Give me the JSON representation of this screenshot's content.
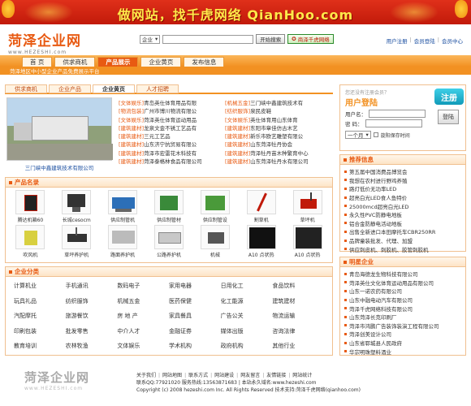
{
  "banner": {
    "text": "做网站，找千虎网络 QianHoo.com"
  },
  "logo": {
    "name": "菏泽企业网",
    "domain": "www.HEZESHI.com"
  },
  "search": {
    "scope": "企业",
    "button": "开始搜索",
    "free_button": "商泽千虎网络"
  },
  "top_links": [
    "用户注册",
    "会员登陆",
    "会员中心"
  ],
  "nav": {
    "items": [
      "首 页",
      "供求商机",
      "产品展示",
      "企业黄页",
      "发布信息"
    ],
    "active": 2
  },
  "subnav": {
    "text": "菏泽地区中小型企业产品免费展示平台"
  },
  "tabs": {
    "items": [
      "供求商机",
      "企业产品",
      "企业黄页",
      "人才招聘"
    ],
    "active": 2
  },
  "feature": {
    "caption": "三门峡中鑫建筑技术有限公司"
  },
  "news": [
    [
      {
        "tag": "[文体娱乐]",
        "text": "青岛英仕体育用品有限"
      },
      {
        "tag": "[机械五金]",
        "text": "三门峡中鑫建筑技术有"
      }
    ],
    [
      {
        "tag": "[物流包装]",
        "text": "广州市博川物流有限公"
      },
      {
        "tag": "[纺织服饰]",
        "text": "泉民皮鞋"
      }
    ],
    [
      {
        "tag": "[文体娱乐]",
        "text": "菏泽英仕体育运动用品"
      },
      {
        "tag": "[文体娱乐]",
        "text": "英仕体育用山东体育"
      }
    ],
    [
      {
        "tag": "[建筑建材]",
        "text": "龙泉文金不锈工艺品有"
      },
      {
        "tag": "[建筑建材]",
        "text": "东阳市章佳仿古木艺"
      }
    ],
    [
      {
        "tag": "[建筑建材]",
        "text": "三元工艺品"
      },
      {
        "tag": "[建筑建材]",
        "text": "新乐市欧艺雕塑有限公"
      }
    ],
    [
      {
        "tag": "[建筑建材]",
        "text": "山东济宁抗贸易有限公"
      },
      {
        "tag": "[建筑建材]",
        "text": "山东菏泽牡丹协会"
      }
    ],
    [
      {
        "tag": "[建筑建材]",
        "text": "菏泽市宏雷花木科技有"
      },
      {
        "tag": "[建筑建材]",
        "text": "菏泽牡丹苗木种繁育中心"
      }
    ],
    [
      {
        "tag": "[建筑建材]",
        "text": "菏泽泰格林食品有限公司"
      },
      {
        "tag": "[建筑建材]",
        "text": "山东菏泽牡丹水有限公司"
      }
    ]
  ],
  "login": {
    "hint": "您还没有注册会员？",
    "title": "用户登陆",
    "register": "注册",
    "username_label": "用户名：",
    "password_label": "密  码：",
    "login_button": "登陆",
    "expiry": "一个月",
    "remember": "旋阳保存时间"
  },
  "recommend": {
    "title": "推荐信息",
    "items": [
      "第五届中国消费品博览会",
      "我想在农村进行野鸡养殖",
      "路灯低价无功率LED",
      "超亮白光LED食人鱼特价",
      "25000mcd超亮白光LED",
      "永久性PVC防静电地板",
      "铝合金防静电活动地板",
      "出售全新进口本田摩托车CBR250RR",
      "品牌童装批发、代理、加盟",
      "供应刺皮机、刺胶机、胶管刺胶机"
    ]
  },
  "members": {
    "title": "明星企业",
    "items": [
      "青岛海德龙生物科技有限公司",
      "菏泽英仕文化体育运动用品有限公司",
      "山东一诺农药有限公司",
      "山东中融电动汽车有限公司",
      "菏泽千虎网络科技有限公司",
      "山东菏泽长克印刷厂",
      "菏泽市鸿鹏广告装饰装演工程有限公司",
      "菏泽创美设计公司",
      "山东省郓城县人民政府",
      "华宗明珠塑料酒业"
    ]
  },
  "products": {
    "title": "产品名录",
    "items": [
      "腾达机箱60",
      "长城cesocm",
      "供应制管机",
      "供应制管材",
      "供应制管设",
      "割草机",
      "草坪机",
      "吹风机",
      "草坪养护机",
      "路面养护机",
      "公路养护机",
      "机械",
      "A10 点状热",
      "A10 点状热"
    ]
  },
  "categories": {
    "title": "企业分类",
    "items": [
      "计算机业",
      "手机通讯",
      "数码电子",
      "家用电器",
      "日用化工",
      "食品饮料",
      "玩具礼品",
      "纺织服饰",
      "机械五金",
      "医药保健",
      "化工能源",
      "建筑建材",
      "汽配摩托",
      "旅游餐饮",
      "房 地 产",
      "家具餐具",
      "广告公关",
      "物流运输",
      "印刷包装",
      "批发零售",
      "中介人才",
      "金融证券",
      "媒体出版",
      "咨询法律",
      "教育培训",
      "农林牧渔",
      "文体娱乐",
      "学术机构",
      "政府机构",
      "其他行业"
    ]
  },
  "footer": {
    "links": [
      "关于我们",
      "网站地图",
      "联系方式",
      "网站建设",
      "网友留言",
      "友情链接",
      "网站统计"
    ],
    "contact": "联系QQ:77921020  服务热线:13563871683  | 本站永久域名:www.hezeshi.com",
    "copyright": "Copyright (c) 2008 hezeshi.com Inc. All Rights Reserved 技术支持:菏泽千虎网络(qianhoo.com)"
  }
}
